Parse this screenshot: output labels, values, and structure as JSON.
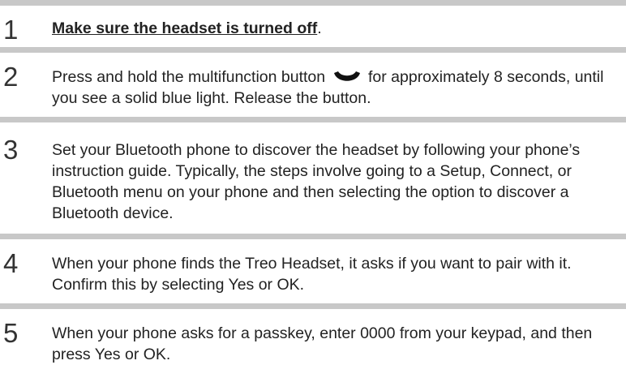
{
  "steps": [
    {
      "number": "1",
      "bold_link_text": "Make sure the headset is turned off",
      "suffix": "."
    },
    {
      "number": "2",
      "text_before_icon": "Press and hold the multifunction button",
      "icon": "multifunction-button-icon",
      "text_after_icon": " for approximately 8 seconds, until you see a solid blue light. Release the button."
    },
    {
      "number": "3",
      "text": "Set your Bluetooth phone to discover the headset by following your phone’s instruction guide. Typically, the steps involve going to a Setup, Connect, or Bluetooth menu on your phone and then selecting the option to discover a Bluetooth device."
    },
    {
      "number": "4",
      "text": "When your phone finds the Treo Headset, it asks if you want to pair with it. Confirm this by selecting Yes or OK."
    },
    {
      "number": "5",
      "text": "When your phone asks for a passkey, enter 0000 from your keypad, and then press Yes or OK."
    }
  ],
  "colors": {
    "rule": "#c8c8c8",
    "number": "#333333",
    "text": "#222222"
  }
}
